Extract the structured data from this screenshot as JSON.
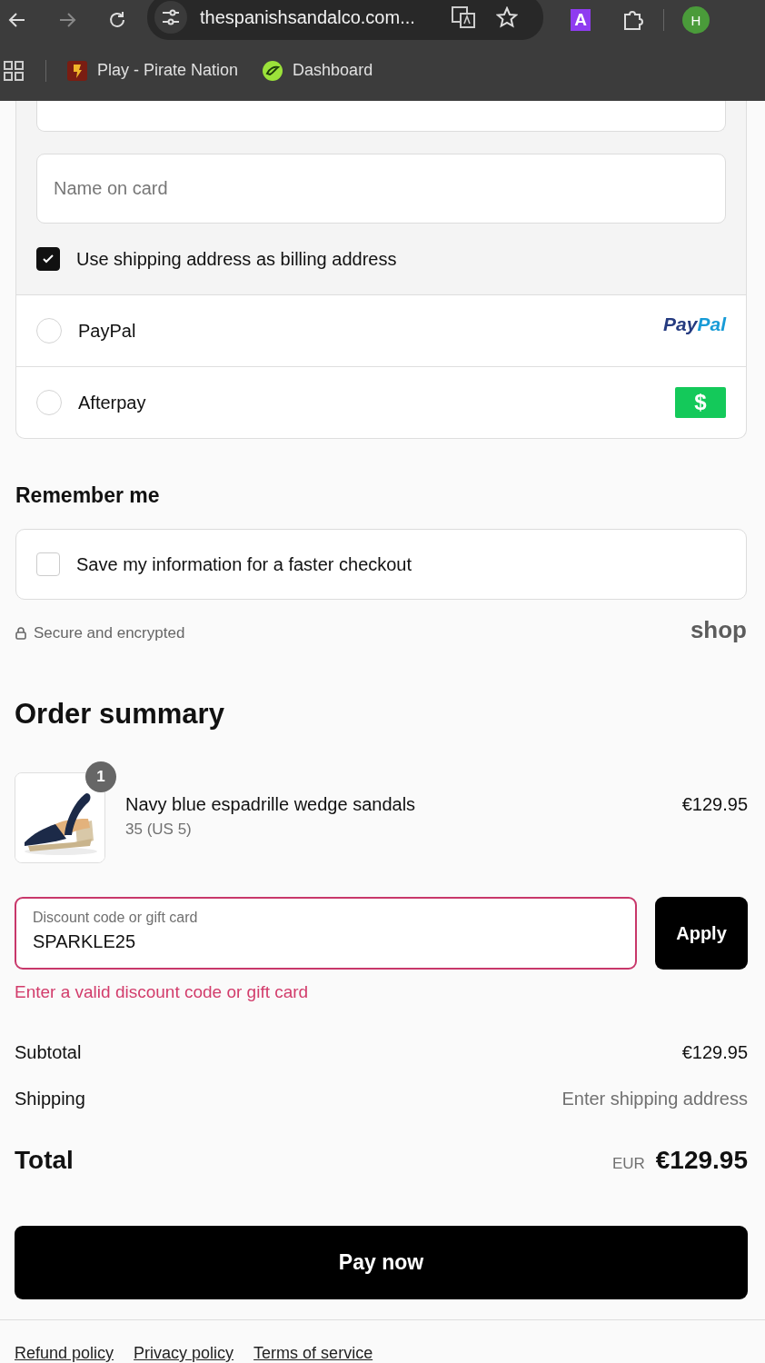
{
  "browser": {
    "url": "thespanishsandalco.com...",
    "extension_letter": "A",
    "profile_initial": "H",
    "bookmarks": [
      {
        "label": "Play - Pirate Nation",
        "kind": "pirate"
      },
      {
        "label": "Dashboard",
        "kind": "dashboard"
      }
    ]
  },
  "payment": {
    "card_fields": [
      {
        "placeholder": "Name on card"
      }
    ],
    "billing_same": {
      "label": "Use shipping address as billing address",
      "checked": true
    },
    "methods": [
      {
        "label": "PayPal",
        "selected": false,
        "kind": "paypal",
        "logo_parts": [
          "Pay",
          "Pal"
        ]
      },
      {
        "label": "Afterpay",
        "selected": false,
        "kind": "afterpay",
        "logo_parts": [
          "$"
        ]
      }
    ]
  },
  "remember": {
    "heading": "Remember me",
    "option": {
      "label": "Save my information for a faster checkout",
      "checked": false
    }
  },
  "security_note": "Secure and encrypted",
  "shop_logo": "shop",
  "summary": {
    "heading": "Order summary",
    "items": [
      {
        "name": "Navy blue espadrille wedge sandals",
        "variant": "35 (US 5)",
        "price": "€129.95",
        "quantity": "1"
      }
    ],
    "discount": {
      "label": "Discount code or gift card",
      "value": "SPARKLE25",
      "error": "Enter a valid discount code or gift card",
      "button": "Apply"
    },
    "lines": [
      {
        "label": "Subtotal",
        "value": "€129.95",
        "kind": "amount"
      },
      {
        "label": "Shipping",
        "value": "Enter shipping address",
        "kind": "note"
      }
    ],
    "total": {
      "label": "Total",
      "currency": "EUR",
      "value": "€129.95"
    }
  },
  "pay_button": "Pay now",
  "footer_links": [
    "Refund policy",
    "Privacy policy",
    "Terms of service"
  ]
}
